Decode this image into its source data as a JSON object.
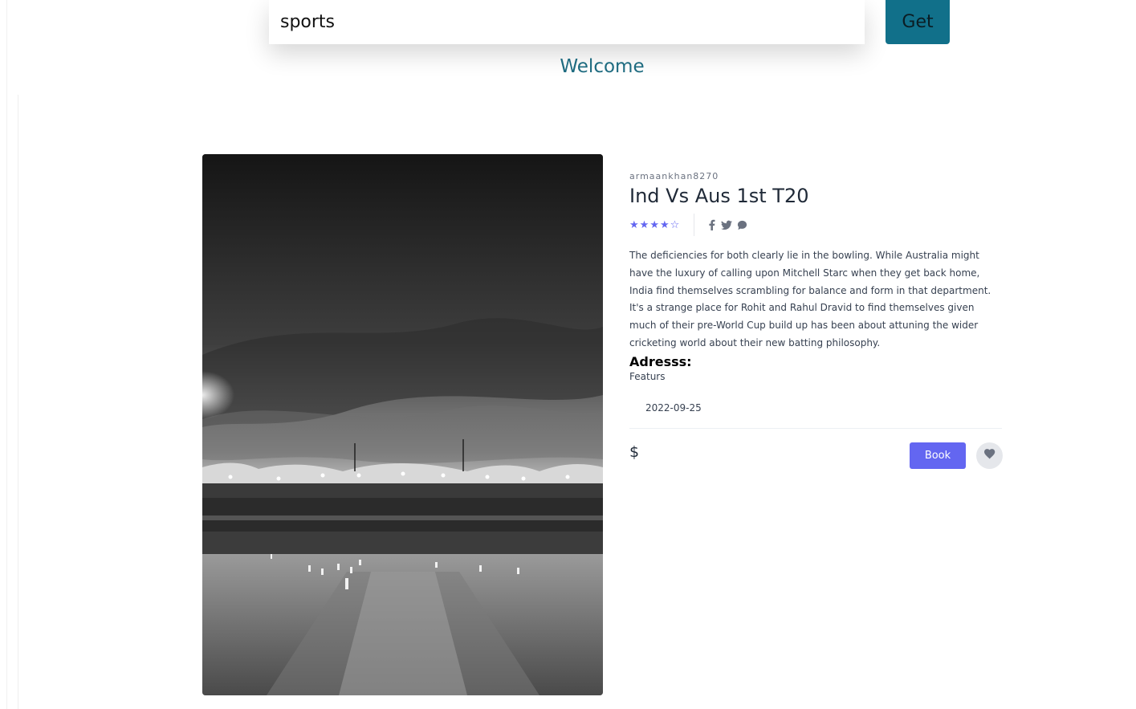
{
  "search": {
    "value": "sports"
  },
  "get_button": {
    "label": "Get"
  },
  "welcome": "Welcome",
  "event": {
    "username": "armaankhan8270",
    "title": "Ind Vs Aus 1st T20",
    "rating": {
      "value": 4,
      "max": 5
    },
    "socials": [
      "facebook-icon",
      "twitter-icon",
      "chat-icon"
    ],
    "description": "The deficiencies for both clearly lie in the bowling. While Australia might have the luxury of calling upon Mitchell Starc when they get back home, India find themselves scrambling for balance and form in that department. It's a strange place for Rohit and Rahul Dravid to find themselves given much of their pre-World Cup build up has been about attuning the wider cricketing world about their new batting philosophy.",
    "address_label": "Adresss:",
    "features": "Featurs",
    "date": "2022-09-25",
    "price": "$",
    "book_label": "Book"
  },
  "colors": {
    "accent": "#6366f1",
    "get_button": "#11708a",
    "welcome": "#1e6b80"
  }
}
